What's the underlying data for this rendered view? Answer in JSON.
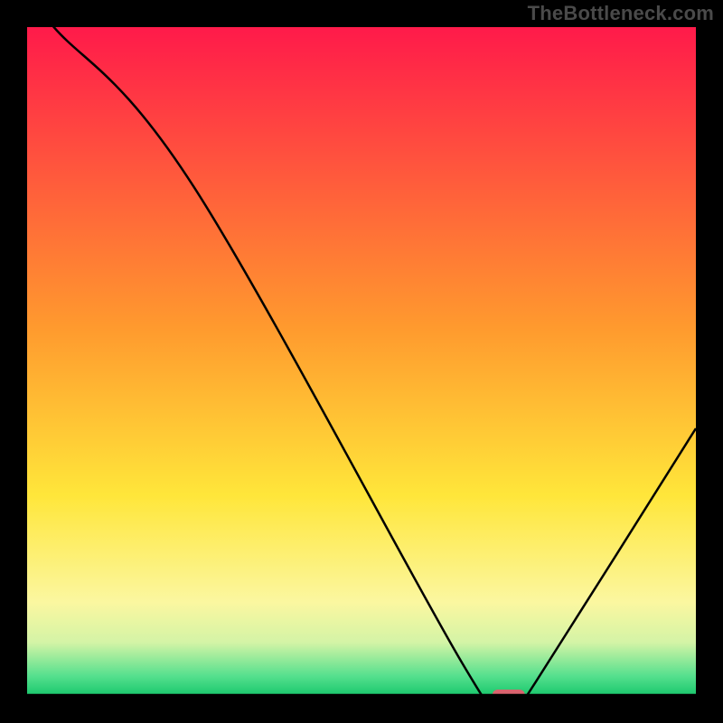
{
  "watermark": "TheBottleneck.com",
  "chart_data": {
    "type": "line",
    "title": "",
    "xlabel": "",
    "ylabel": "",
    "xlim": [
      0,
      100
    ],
    "ylim": [
      0,
      100
    ],
    "x": [
      0,
      4,
      25,
      65,
      70,
      74,
      76,
      100
    ],
    "values": [
      105,
      100,
      76,
      5,
      0,
      0,
      2,
      40
    ],
    "marker": {
      "x": 72,
      "y": 0,
      "color": "#d9636e"
    },
    "background_gradient": {
      "stops": [
        {
          "offset": 0.0,
          "color": "#ff1a4a"
        },
        {
          "offset": 0.45,
          "color": "#ff9a2e"
        },
        {
          "offset": 0.7,
          "color": "#ffe63a"
        },
        {
          "offset": 0.86,
          "color": "#fbf7a0"
        },
        {
          "offset": 0.92,
          "color": "#d4f4a6"
        },
        {
          "offset": 0.97,
          "color": "#56e08e"
        },
        {
          "offset": 1.0,
          "color": "#18c76c"
        }
      ]
    }
  }
}
